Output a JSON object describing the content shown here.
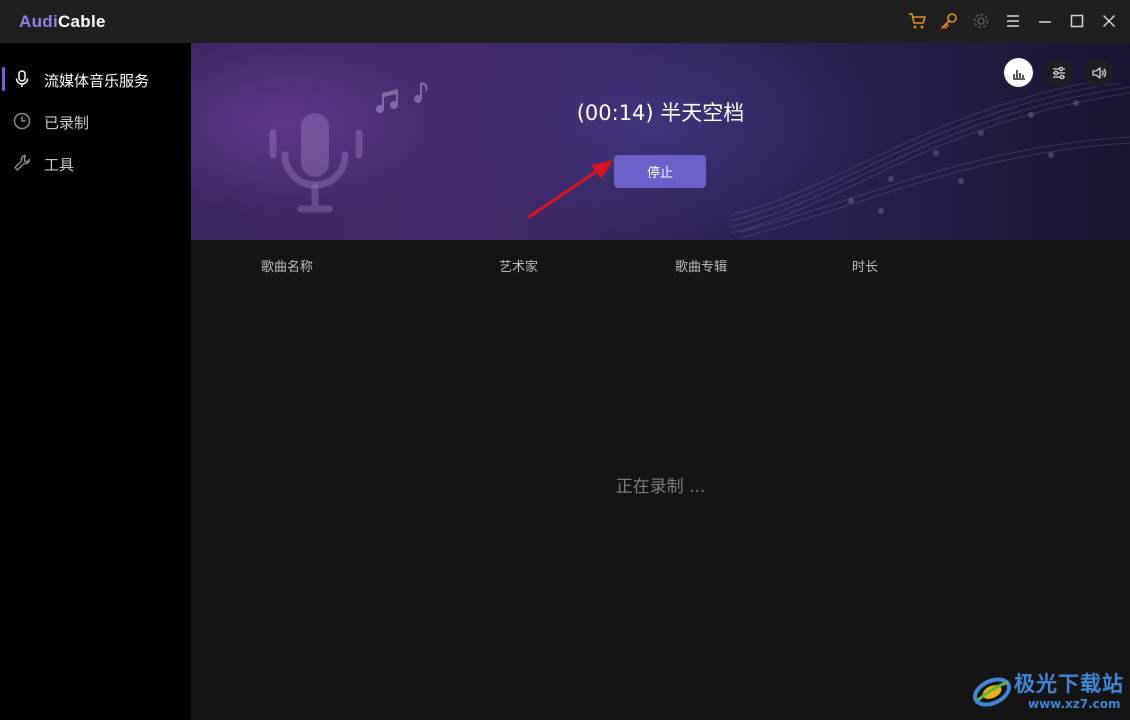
{
  "app": {
    "logo_part1": "Audi",
    "logo_part2": "Cable"
  },
  "titlebar": {
    "icons": [
      "cart-icon",
      "key-icon",
      "gear-icon",
      "menu-icon",
      "minimize-icon",
      "maximize-icon",
      "close-icon"
    ]
  },
  "sidebar": {
    "items": [
      {
        "label": "流媒体音乐服务",
        "icon": "microphone-icon",
        "active": true
      },
      {
        "label": "已录制",
        "icon": "clock-icon",
        "active": false
      },
      {
        "label": "工具",
        "icon": "wrench-icon",
        "active": false
      }
    ]
  },
  "banner": {
    "title": "(00:14) 半天空档",
    "stop_label": "停止",
    "buttons": [
      "equalizer-icon",
      "sliders-icon",
      "volume-icon"
    ]
  },
  "table": {
    "headers": [
      "歌曲名称",
      "艺术家",
      "歌曲专辑",
      "时长"
    ]
  },
  "status": {
    "recording_text": "正在录制 ..."
  },
  "watermark": {
    "brand": "极光下载站",
    "site": "www.xz7.com"
  },
  "colors": {
    "accent": "#6b5fc9",
    "logo_accent": "#8f84e6",
    "titlebar_icons": "#e0922a",
    "arrow": "#d4141e"
  }
}
